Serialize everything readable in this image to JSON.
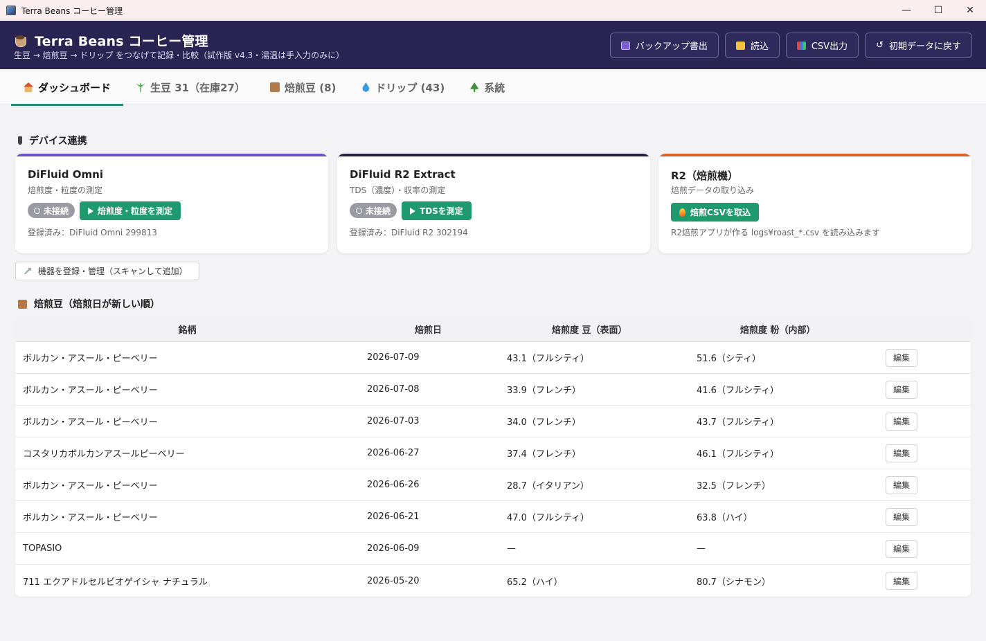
{
  "window": {
    "title": "Terra Beans コーヒー管理"
  },
  "header": {
    "title": "Terra Beans コーヒー管理",
    "subtitle": "生豆 → 焙煎豆 → ドリップ をつなげて記録・比較（試作版 v4.3・湯温は手入力のみに）",
    "buttons": {
      "backup": "バックアップ書出",
      "load": "読込",
      "csv": "CSV出力",
      "reset": "初期データに戻す"
    }
  },
  "tabs": [
    {
      "label": "ダッシュボード",
      "icon": "house-icon",
      "active": true
    },
    {
      "label": "生豆 31（在庫27）",
      "icon": "sprout-icon"
    },
    {
      "label": "焙煎豆 (8)",
      "icon": "box-icon"
    },
    {
      "label": "ドリップ (43)",
      "icon": "droplet-icon"
    },
    {
      "label": "系統",
      "icon": "tree-icon"
    }
  ],
  "devices_section": {
    "title": "デバイス連携",
    "cards": [
      {
        "name": "DiFluid Omni",
        "desc": "焙煎度・粒度の測定",
        "status": "未接続",
        "action": "焙煎度・粒度を測定",
        "note": "登録済み：DiFluid Omni 299813",
        "accent": "#6a4fc8"
      },
      {
        "name": "DiFluid R2 Extract",
        "desc": "TDS（濃度）・収率の測定",
        "status": "未接続",
        "action": "TDSを測定",
        "note": "登録済み：DiFluid R2 302194",
        "accent": "#232046"
      },
      {
        "name": "R2（焙煎機）",
        "desc": "焙煎データの取り込み",
        "action": "焙煎CSVを取込",
        "note": "R2焙煎アプリが作る logs¥roast_*.csv を読み込みます",
        "accent": "#e0622a"
      }
    ],
    "manage_button": "機器を登録・管理（スキャンして追加）"
  },
  "roasted_section": {
    "title": "焙煎豆（焙煎日が新しい順）",
    "columns": [
      "銘柄",
      "焙煎日",
      "焙煎度 豆（表面）",
      "焙煎度 粉（内部）"
    ],
    "edit_label": "編集",
    "rows": [
      {
        "name": "ボルカン・アスール・ピーベリー",
        "date": "2026-07-09",
        "bean": "43.1（フルシティ）",
        "ground": "51.6（シティ）"
      },
      {
        "name": "ボルカン・アスール・ピーベリー",
        "date": "2026-07-08",
        "bean": "33.9（フレンチ）",
        "ground": "41.6（フルシティ）"
      },
      {
        "name": "ボルカン・アスール・ピーベリー",
        "date": "2026-07-03",
        "bean": "34.0（フレンチ）",
        "ground": "43.7（フルシティ）"
      },
      {
        "name": "コスタリカボルカンアスールピーベリー",
        "date": "2026-06-27",
        "bean": "37.4（フレンチ）",
        "ground": "46.1（フルシティ）"
      },
      {
        "name": "ボルカン・アスール・ピーベリー",
        "date": "2026-06-26",
        "bean": "28.7（イタリアン）",
        "ground": "32.5（フレンチ）"
      },
      {
        "name": "ボルカン・アスール・ピーベリー",
        "date": "2026-06-21",
        "bean": "47.0（フルシティ）",
        "ground": "63.8（ハイ）"
      },
      {
        "name": "TOPASIO",
        "date": "2026-06-09",
        "bean": "—",
        "ground": "—"
      },
      {
        "name": "711 エクアドルセルビオゲイシャ ナチュラル",
        "date": "2026-05-20",
        "bean": "65.2（ハイ）",
        "ground": "80.7（シナモン）"
      }
    ]
  }
}
